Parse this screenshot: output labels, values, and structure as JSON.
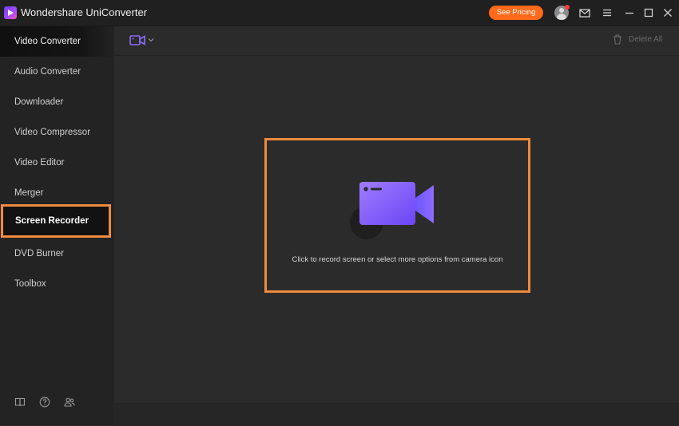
{
  "app": {
    "title": "Wondershare UniConverter",
    "pricing_label": "See Pricing",
    "accent_color": "#ff6a1a"
  },
  "titlebar_icons": [
    "user-avatar-icon",
    "mail-icon",
    "menu-icon",
    "minimize-icon",
    "maximize-icon",
    "close-icon"
  ],
  "sidebar": {
    "items": [
      {
        "label": "Video Converter"
      },
      {
        "label": "Audio Converter"
      },
      {
        "label": "Downloader"
      },
      {
        "label": "Video Compressor"
      },
      {
        "label": "Video Editor"
      },
      {
        "label": "Merger"
      },
      {
        "label": "Screen Recorder",
        "active": true
      },
      {
        "label": "DVD Burner"
      },
      {
        "label": "Toolbox"
      }
    ],
    "bottom_icons": [
      "book-icon",
      "help-icon",
      "community-icon"
    ]
  },
  "toolbar": {
    "camera_icon": "camera-icon",
    "delete_all_label": "Delete All"
  },
  "main": {
    "record_hint": "Click to record screen or select more options from camera icon",
    "highlight_color": "#f08a3c",
    "camera_gradient": [
      "#7b5cff",
      "#a884ff"
    ]
  }
}
